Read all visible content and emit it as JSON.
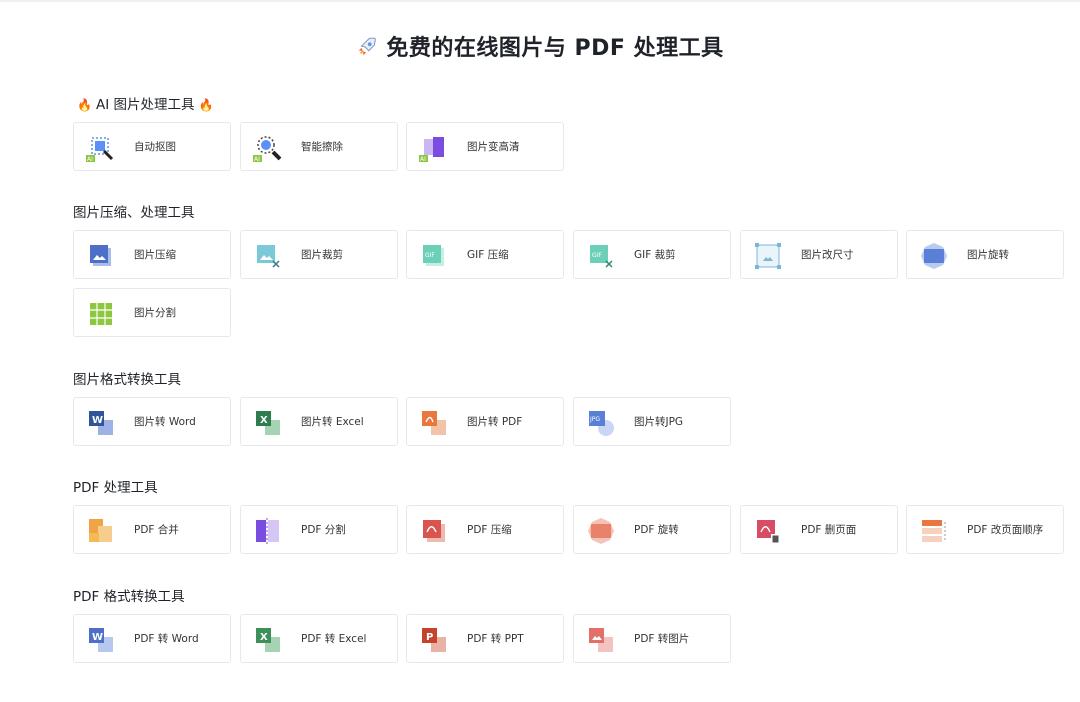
{
  "title": "免费的在线图片与 PDF 处理工具",
  "sections": [
    {
      "heading": "AI 图片处理工具",
      "items": [
        {
          "label": "自动抠图",
          "icon": "ai-cutout-icon"
        },
        {
          "label": "智能擦除",
          "icon": "ai-erase-icon"
        },
        {
          "label": "图片变高清",
          "icon": "ai-enhance-icon"
        }
      ]
    },
    {
      "heading": "图片压缩、处理工具",
      "items": [
        {
          "label": "图片压缩",
          "icon": "image-compress-icon"
        },
        {
          "label": "图片裁剪",
          "icon": "image-crop-icon"
        },
        {
          "label": "GIF 压缩",
          "icon": "gif-compress-icon"
        },
        {
          "label": "GIF 裁剪",
          "icon": "gif-crop-icon"
        },
        {
          "label": "图片改尺寸",
          "icon": "image-resize-icon"
        },
        {
          "label": "图片旋转",
          "icon": "image-rotate-icon"
        },
        {
          "label": "图片分割",
          "icon": "image-split-icon"
        }
      ]
    },
    {
      "heading": "图片格式转换工具",
      "items": [
        {
          "label": "图片转 Word",
          "icon": "image-to-word-icon"
        },
        {
          "label": "图片转 Excel",
          "icon": "image-to-excel-icon"
        },
        {
          "label": "图片转 PDF",
          "icon": "image-to-pdf-icon"
        },
        {
          "label": "图片转JPG",
          "icon": "image-to-jpg-icon"
        }
      ]
    },
    {
      "heading": "PDF 处理工具",
      "items": [
        {
          "label": "PDF 合并",
          "icon": "pdf-merge-icon"
        },
        {
          "label": "PDF 分割",
          "icon": "pdf-split-icon"
        },
        {
          "label": "PDF 压缩",
          "icon": "pdf-compress-icon"
        },
        {
          "label": "PDF 旋转",
          "icon": "pdf-rotate-icon"
        },
        {
          "label": "PDF 删页面",
          "icon": "pdf-delete-pages-icon"
        },
        {
          "label": "PDF 改页面顺序",
          "icon": "pdf-reorder-icon"
        }
      ]
    },
    {
      "heading": "PDF 格式转换工具",
      "items": [
        {
          "label": "PDF 转 Word",
          "icon": "pdf-to-word-icon"
        },
        {
          "label": "PDF 转 Excel",
          "icon": "pdf-to-excel-icon"
        },
        {
          "label": "PDF 转 PPT",
          "icon": "pdf-to-ppt-icon"
        },
        {
          "label": "PDF 转图片",
          "icon": "pdf-to-image-icon"
        }
      ]
    }
  ],
  "colors": {
    "ai_blue": "#5b8ff9",
    "ai_purple": "#7b4ce0",
    "image_blue": "#5a7fd6",
    "teal": "#6ccfb8",
    "word_blue": "#2f5699",
    "excel_green": "#2e7d4f",
    "pdf_red": "#d9534f",
    "pdf_orange": "#f0a444",
    "ppt_red": "#c4442b",
    "split_green": "#8dc63f",
    "fire": "#f25c1b"
  },
  "icon_text": {
    "ai_badge": "AI",
    "word_letter": "W",
    "excel_letter": "X",
    "ppt_letter": "P",
    "gif_badge": "GIF",
    "jpg_badge": "JPG"
  }
}
